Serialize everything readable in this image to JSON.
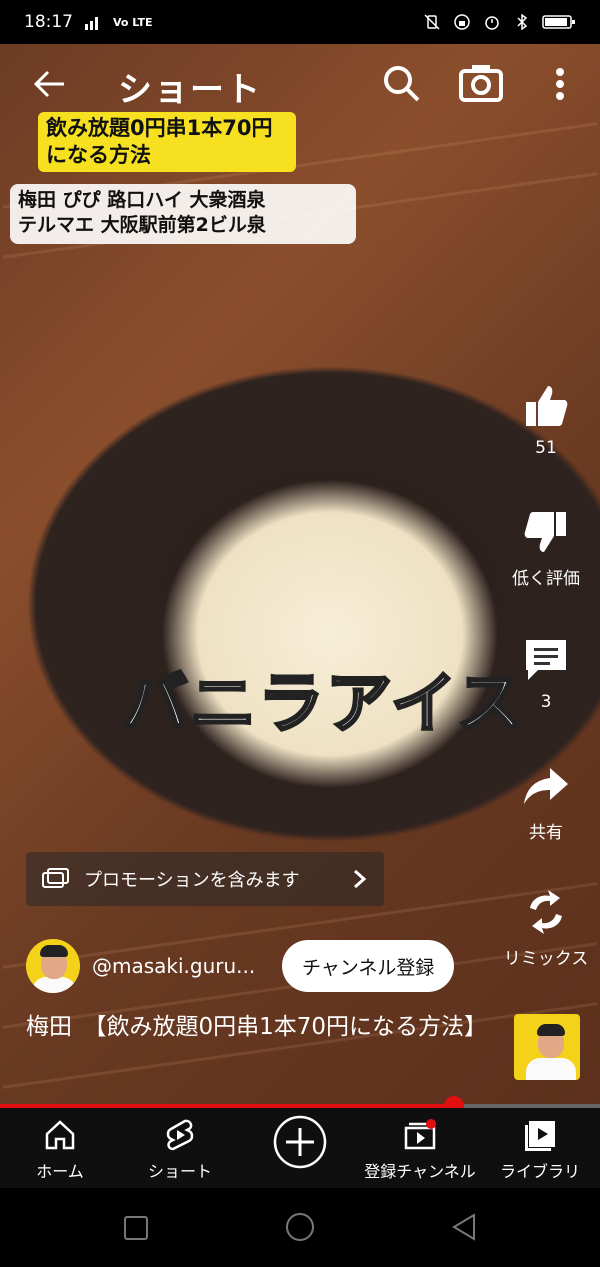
{
  "status_bar": {
    "time": "18:17",
    "network": "4G",
    "volte": "Vo LTE"
  },
  "top_bar": {
    "title": "ショート"
  },
  "video": {
    "banner_top": "飲み放題0円串1本70円\nになる方法",
    "banner_location": "梅田 ぴぴ 路口ハイ 大衆酒泉\nテルマエ 大阪駅前第2ビル泉",
    "caption": "バニラアイス"
  },
  "actions": {
    "like_count": "51",
    "dislike_label": "低く評価",
    "comment_count": "3",
    "share_label": "共有",
    "remix_label": "リミックス"
  },
  "promotion": {
    "label": "プロモーションを含みます"
  },
  "channel": {
    "handle": "@masaki.guru...",
    "subscribe_label": "チャンネル登録"
  },
  "video_title": "梅田　【飲み放題0円串1本70円になる方法】",
  "playback": {
    "progress_fraction": 0.757
  },
  "bottom_nav": {
    "home": "ホーム",
    "shorts": "ショート",
    "subscriptions": "登録チャンネル",
    "library": "ライブラリ"
  },
  "colors": {
    "accent_red": "#e01010",
    "banner_yellow": "#f6e020"
  }
}
